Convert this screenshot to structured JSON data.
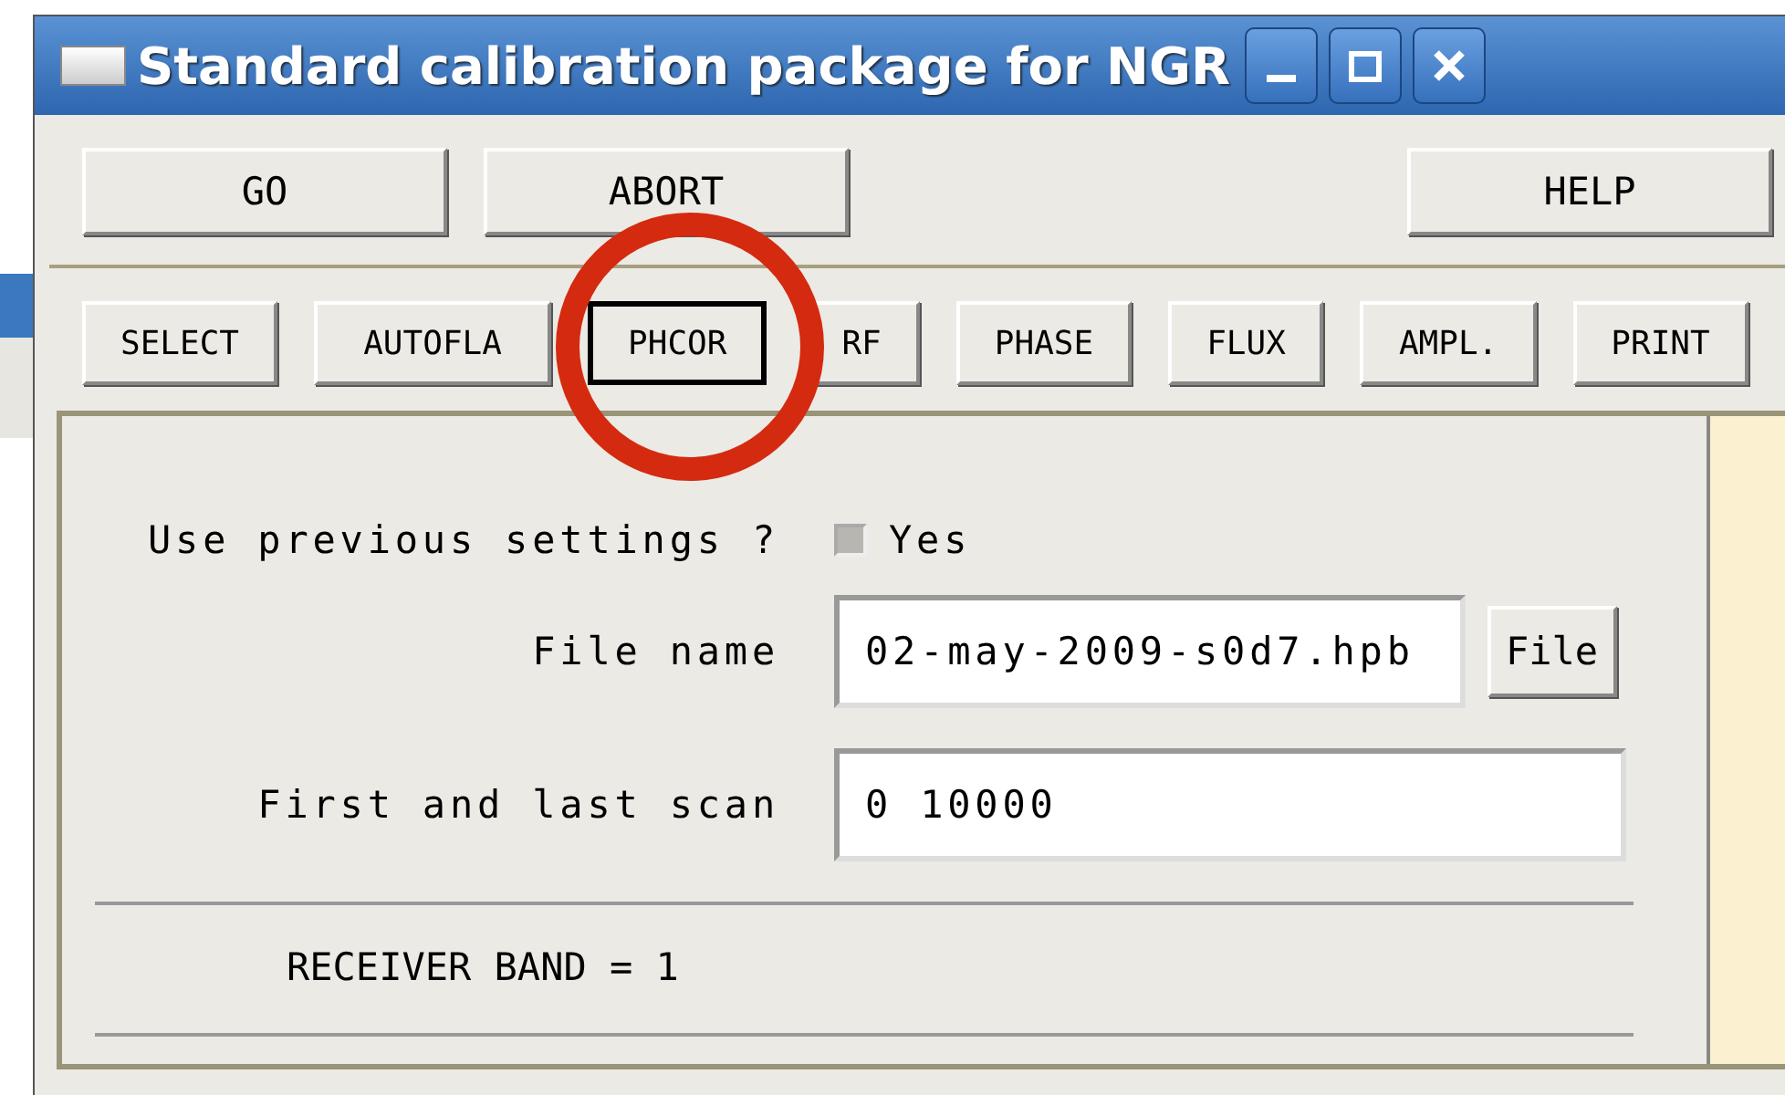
{
  "window": {
    "title": "Standard calibration package for NGR"
  },
  "top_buttons": [
    {
      "label": "GO"
    },
    {
      "label": "ABORT"
    },
    {
      "label": "HELP"
    }
  ],
  "tabs": [
    {
      "label": "SELECT",
      "selected": false
    },
    {
      "label": "AUTOFLA",
      "selected": false
    },
    {
      "label": "PHCOR",
      "selected": true
    },
    {
      "label": "RF",
      "selected": false
    },
    {
      "label": "PHASE",
      "selected": false
    },
    {
      "label": "FLUX",
      "selected": false
    },
    {
      "label": "AMPL.",
      "selected": false
    },
    {
      "label": "PRINT",
      "selected": false
    }
  ],
  "form": {
    "use_previous": {
      "label": "Use previous settings ?",
      "option": "Yes",
      "checked": true
    },
    "fields": [
      {
        "label": "File name",
        "value": "02-may-2009-s0d7.hpb",
        "button": "File"
      },
      {
        "label": "First and last scan",
        "value": "0 10000"
      }
    ],
    "status": "RECEIVER BAND = 1"
  }
}
